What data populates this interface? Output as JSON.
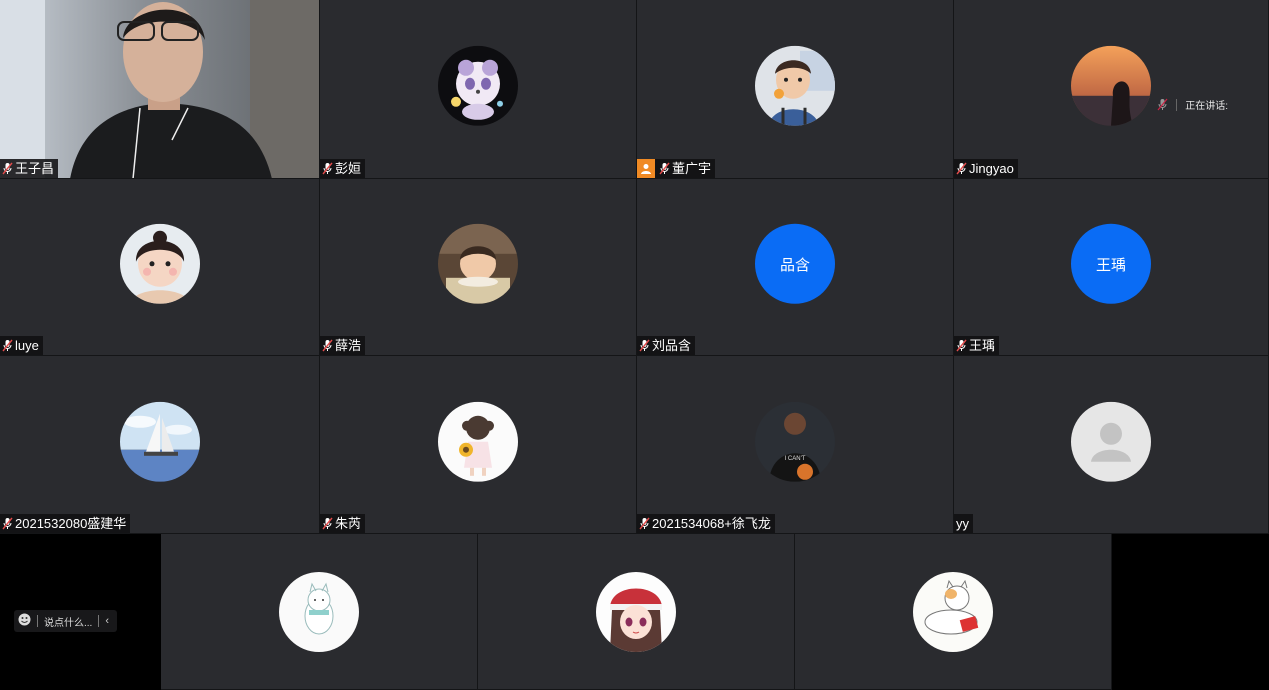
{
  "speaking_indicator": {
    "label": "正在讲话:"
  },
  "chat": {
    "placeholder": "说点什么...",
    "collapse_icon": "chevron-left-icon",
    "emoji_icon": "smiley-icon"
  },
  "participants": [
    {
      "name": "王子昌",
      "type": "video"
    },
    {
      "name": "彭姮",
      "type": "avatar",
      "avatar": "panda-cartoon"
    },
    {
      "name": "董广宇",
      "type": "avatar",
      "avatar": "toddler-photo",
      "host": true
    },
    {
      "name": "Jingyao",
      "type": "avatar",
      "avatar": "sunset-silhouette"
    },
    {
      "name": "luye",
      "type": "avatar",
      "avatar": "little-girl-photo"
    },
    {
      "name": "薛浩",
      "type": "avatar",
      "avatar": "child-reading-photo"
    },
    {
      "name": "刘品含",
      "type": "text-avatar",
      "avatar_text": "品含"
    },
    {
      "name": "王瑀",
      "type": "text-avatar",
      "avatar_text": "王瑀"
    },
    {
      "name": "2021532080盛建华",
      "type": "avatar",
      "avatar": "sailboat-sea"
    },
    {
      "name": "朱芮",
      "type": "avatar",
      "avatar": "girl-sunflower-drawing"
    },
    {
      "name": "2021534068+徐飞龙",
      "type": "avatar",
      "avatar": "basketball-player"
    },
    {
      "name": "yy",
      "type": "avatar",
      "avatar": "default-person",
      "no_mic": true
    },
    {
      "type": "avatar",
      "avatar": "white-cat-drawing"
    },
    {
      "type": "avatar",
      "avatar": "anime-girl-red-hat"
    },
    {
      "type": "avatar",
      "avatar": "cat-drawing"
    }
  ],
  "colors": {
    "tile_bg": "#2a2b2f",
    "text_avatar_bg": "#0a6cf5",
    "host_badge": "#f08a24"
  }
}
